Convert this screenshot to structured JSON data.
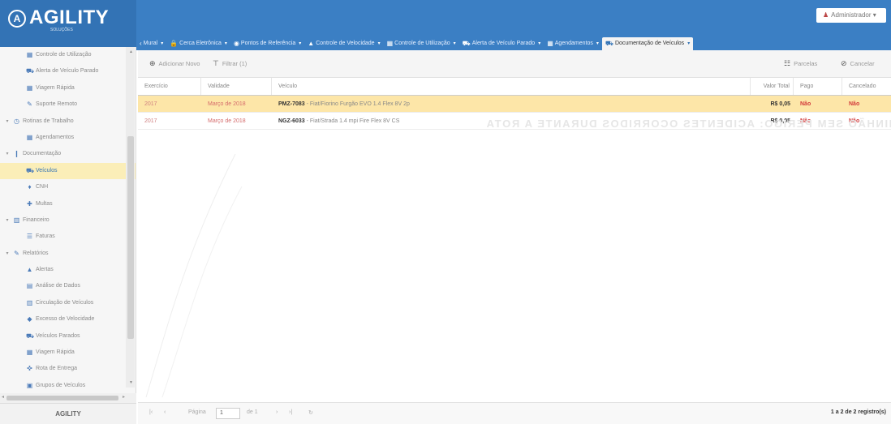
{
  "app": {
    "logo_text": "AGILITY",
    "logo_sub": "SOLUÇÕES",
    "user_label": "Administrador",
    "footer": "AGILITY"
  },
  "tabs": [
    {
      "icon": "home-icon",
      "glyph": "‹",
      "label": "Mural",
      "active": false
    },
    {
      "icon": "lock-icon",
      "glyph": "🔒",
      "label": "Cerca Eletrônica",
      "active": false
    },
    {
      "icon": "globe-icon",
      "glyph": "◉",
      "label": "Pontos de Referência",
      "active": false
    },
    {
      "icon": "warning-icon",
      "glyph": "▲",
      "label": "Controle de Velocidade",
      "active": false
    },
    {
      "icon": "calendar-icon",
      "glyph": "▦",
      "label": "Controle de Utilização",
      "active": false
    },
    {
      "icon": "car-icon",
      "glyph": "⛟",
      "label": "Alerta de Veículo Parado",
      "active": false
    },
    {
      "icon": "calendar-icon",
      "glyph": "▦",
      "label": "Agendamentos",
      "active": false
    },
    {
      "icon": "car-icon",
      "glyph": "⛟",
      "label": "Documentação de Veículos",
      "active": true
    }
  ],
  "sidebar": {
    "items": [
      {
        "level": 1,
        "icon": "calendar-icon",
        "glyph": "▦",
        "caret": "",
        "label": "Controle de Utilização",
        "active": false
      },
      {
        "level": 1,
        "icon": "car-icon",
        "glyph": "⛟",
        "caret": "",
        "label": "Alerta de Veículo Parado",
        "active": false
      },
      {
        "level": 1,
        "icon": "calendar-icon",
        "glyph": "▦",
        "caret": "",
        "label": "Viagem Rápida",
        "active": false
      },
      {
        "level": 1,
        "icon": "wrench-icon",
        "glyph": "✎",
        "caret": "",
        "label": "Suporte Remoto",
        "active": false
      },
      {
        "level": 0,
        "icon": "clock-icon",
        "glyph": "◷",
        "caret": "▾",
        "label": "Rotinas de Trabalho",
        "active": false
      },
      {
        "level": 1,
        "icon": "calendar-icon",
        "glyph": "▦",
        "caret": "",
        "label": "Agendamentos",
        "active": false
      },
      {
        "level": 0,
        "icon": "file-icon",
        "glyph": "❙",
        "caret": "▾",
        "label": "Documentação",
        "active": false
      },
      {
        "level": 1,
        "icon": "car-icon",
        "glyph": "⛟",
        "caret": "",
        "label": "Veículos",
        "active": true
      },
      {
        "level": 1,
        "icon": "person-icon",
        "glyph": "♦",
        "caret": "",
        "label": "CNH",
        "active": false
      },
      {
        "level": 1,
        "icon": "pin-icon",
        "glyph": "✚",
        "caret": "",
        "label": "Multas",
        "active": false
      },
      {
        "level": 0,
        "icon": "chart-icon",
        "glyph": "▥",
        "caret": "▾",
        "label": "Financeiro",
        "active": false
      },
      {
        "level": 1,
        "icon": "list-icon",
        "glyph": "☰",
        "caret": "",
        "label": "Faturas",
        "active": false
      },
      {
        "level": 0,
        "icon": "report-icon",
        "glyph": "✎",
        "caret": "▾",
        "label": "Relatórios",
        "active": false
      },
      {
        "level": 1,
        "icon": "warning-icon",
        "glyph": "▲",
        "caret": "",
        "label": "Alertas",
        "active": false
      },
      {
        "level": 1,
        "icon": "database-icon",
        "glyph": "▤",
        "caret": "",
        "label": "Análise de Dados",
        "active": false
      },
      {
        "level": 1,
        "icon": "chart-icon",
        "glyph": "▥",
        "caret": "",
        "label": "Circulação de Veículos",
        "active": false
      },
      {
        "level": 1,
        "icon": "speed-icon",
        "glyph": "◆",
        "caret": "",
        "label": "Excesso de Velocidade",
        "active": false
      },
      {
        "level": 1,
        "icon": "car-icon",
        "glyph": "⛟",
        "caret": "",
        "label": "Veículos Parados",
        "active": false
      },
      {
        "level": 1,
        "icon": "calendar-icon",
        "glyph": "▦",
        "caret": "",
        "label": "Viagem Rápida",
        "active": false
      },
      {
        "level": 1,
        "icon": "route-icon",
        "glyph": "✜",
        "caret": "",
        "label": "Rota de Entrega",
        "active": false
      },
      {
        "level": 1,
        "icon": "group-icon",
        "glyph": "▣",
        "caret": "",
        "label": "Grupos de Veículos",
        "active": false
      }
    ]
  },
  "toolbar": {
    "add_label": "Adicionar Novo",
    "filter_label": "Filtrar (1)",
    "installments_label": "Parcelas",
    "cancel_label": "Cancelar"
  },
  "grid": {
    "headers": [
      "Exercício",
      "Validade",
      "Veículo",
      "Valor Total",
      "Pago",
      "Cancelado"
    ],
    "rows": [
      {
        "exercicio": "2017",
        "validade": "Março de 2018",
        "plate": "PMZ-7083",
        "model": " - Fiat/Fiorino Furgão EVO 1.4 Flex 8V 2p",
        "valor": "R$ 0,05",
        "pago": "Não",
        "cancelado": "Não",
        "selected": true
      },
      {
        "exercicio": "2017",
        "validade": "Março de 2018",
        "plate": "NGZ-6033",
        "model": " - Fiat/Strada 1.4 mpi Fire Flex 8V CS",
        "valor": "R$ 0,05",
        "pago": "Não",
        "cancelado": "Não",
        "selected": false
      }
    ]
  },
  "watermark": "CAMINHÃO SEM PERIGO: ACIDENTES OCORRIDOS DURANTE A ROTA",
  "pager": {
    "page_label": "Página",
    "page_value": "1",
    "of_label": "de 1",
    "total": "1 a 2 de 2 registro(s)"
  },
  "colors": {
    "header_blue": "#3b7fc4",
    "selected_row": "#fde6a8",
    "active_sidebar": "#fbeeb8",
    "negative_red": "#d23a3a"
  }
}
